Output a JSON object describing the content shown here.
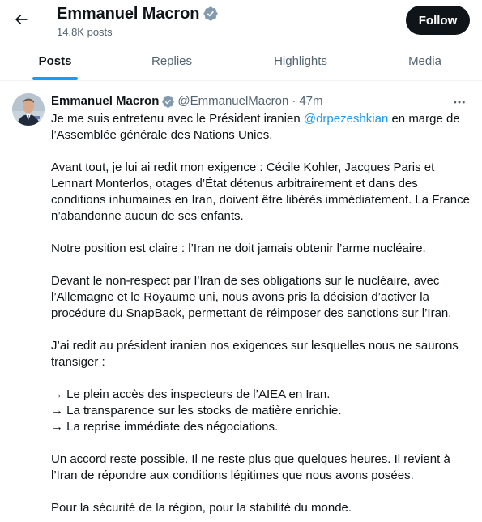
{
  "header": {
    "title": "Emmanuel Macron",
    "post_count": "14.8K posts",
    "follow_label": "Follow"
  },
  "tabs": [
    {
      "label": "Posts",
      "active": true
    },
    {
      "label": "Replies",
      "active": false
    },
    {
      "label": "Highlights",
      "active": false
    },
    {
      "label": "Media",
      "active": false
    }
  ],
  "tweet": {
    "author_name": "Emmanuel Macron",
    "handle": "@EmmanuelMacron",
    "separator": "·",
    "time": "47m",
    "p1_a": "Je me suis entretenu avec le Président iranien ",
    "p1_mention": "@drpezeshkian",
    "p1_b": " en marge de l’Assemblée générale des Nations Unies.",
    "p2": "Avant tout, je lui ai redit mon exigence : Cécile Kohler, Jacques Paris et Lennart Monterlos, otages d’État détenus arbitrairement et dans des conditions inhumaines en Iran, doivent être libérés immédiatement. La France n’abandonne aucun de ses enfants.",
    "p3": "Notre position est claire : l’Iran ne doit jamais obtenir l’arme nucléaire.",
    "p4": "Devant le non-respect par l’Iran de ses obligations sur le nucléaire, avec l’Allemagne et le Royaume uni, nous avons pris la décision d’activer la procédure du SnapBack, permettant de réimposer des sanctions sur l’Iran.",
    "p5": "J’ai redit au président iranien nos exigences sur lesquelles nous ne saurons transiger :",
    "list": [
      "→ Le plein accès des inspecteurs de l’AIEA en Iran.",
      "→ La transparence sur les stocks de matière enrichie.",
      "→ La reprise immédiate des négociations."
    ],
    "p6": "Un accord reste possible. Il ne reste plus que quelques heures. Il revient à l’Iran de répondre aux conditions légitimes que nous avons posées.",
    "p7": "Pour la sécurité de la région, pour la stabilité du monde."
  },
  "icons": {
    "back": "arrow-left-icon",
    "verified": "verified-badge-icon",
    "more": "more-horizontal-icon"
  },
  "colors": {
    "accent": "#1d9bf0",
    "text": "#0f1419",
    "muted": "#536471",
    "button_bg": "#0f1419"
  }
}
